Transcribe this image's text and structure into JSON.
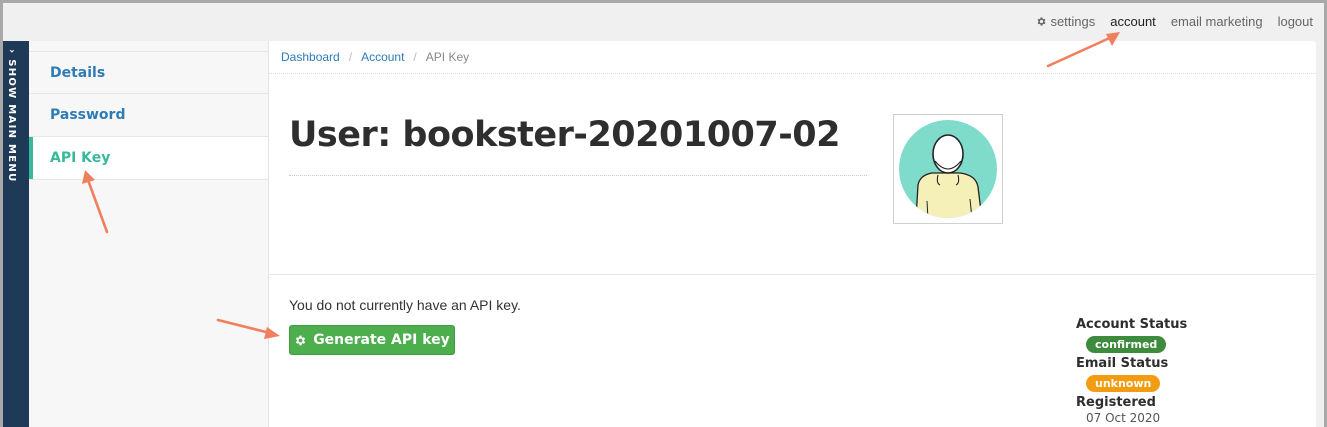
{
  "topnav": {
    "settings": "settings",
    "account": "account",
    "email_marketing": "email marketing",
    "logout": "logout"
  },
  "menu_strip": {
    "label": "› SHOW MAIN MENU"
  },
  "subnav": {
    "items": [
      {
        "label": "Details"
      },
      {
        "label": "Password"
      },
      {
        "label": "API Key"
      }
    ]
  },
  "breadcrumb": {
    "dashboard": "Dashboard",
    "account": "Account",
    "current": "API Key",
    "separator": "/"
  },
  "page": {
    "title": "User: bookster-20201007-02",
    "api_message": "You do not currently have an API key.",
    "generate_button": "Generate API key"
  },
  "status": {
    "account_label": "Account Status",
    "account_value": "confirmed",
    "email_label": "Email Status",
    "email_value": "unknown",
    "registered_label": "Registered",
    "registered_value": "07 Oct 2020"
  },
  "colors": {
    "sidebar_strip": "#1f3a56",
    "link": "#2d7cb5",
    "active_teal": "#38b99c",
    "button_green": "#4cae4c",
    "badge_confirmed": "#3d8b3d",
    "badge_unknown": "#f39c12",
    "annotation_arrow": "#f07f5e"
  },
  "icons": {
    "settings": "gear-icon",
    "generate": "gear-icon",
    "menu": "chevron-right-icon"
  }
}
